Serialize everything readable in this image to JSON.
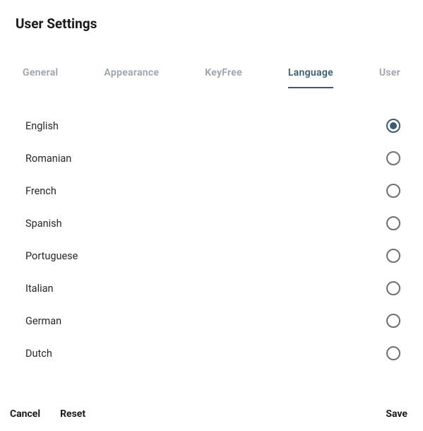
{
  "title": "User Settings",
  "tabs": {
    "general": {
      "label": "General",
      "active": false
    },
    "appearance": {
      "label": "Appearance",
      "active": false
    },
    "keyfree": {
      "label": "KeyFree",
      "active": false
    },
    "language": {
      "label": "Language",
      "active": true
    },
    "user": {
      "label": "User",
      "active": false
    }
  },
  "languages": [
    {
      "label": "English",
      "selected": true
    },
    {
      "label": "Romanian",
      "selected": false
    },
    {
      "label": "French",
      "selected": false
    },
    {
      "label": "Spanish",
      "selected": false
    },
    {
      "label": "Portuguese",
      "selected": false
    },
    {
      "label": "Italian",
      "selected": false
    },
    {
      "label": "German",
      "selected": false
    },
    {
      "label": "Dutch",
      "selected": false
    }
  ],
  "footer": {
    "cancel": "Cancel",
    "reset": "Reset",
    "save": "Save"
  }
}
